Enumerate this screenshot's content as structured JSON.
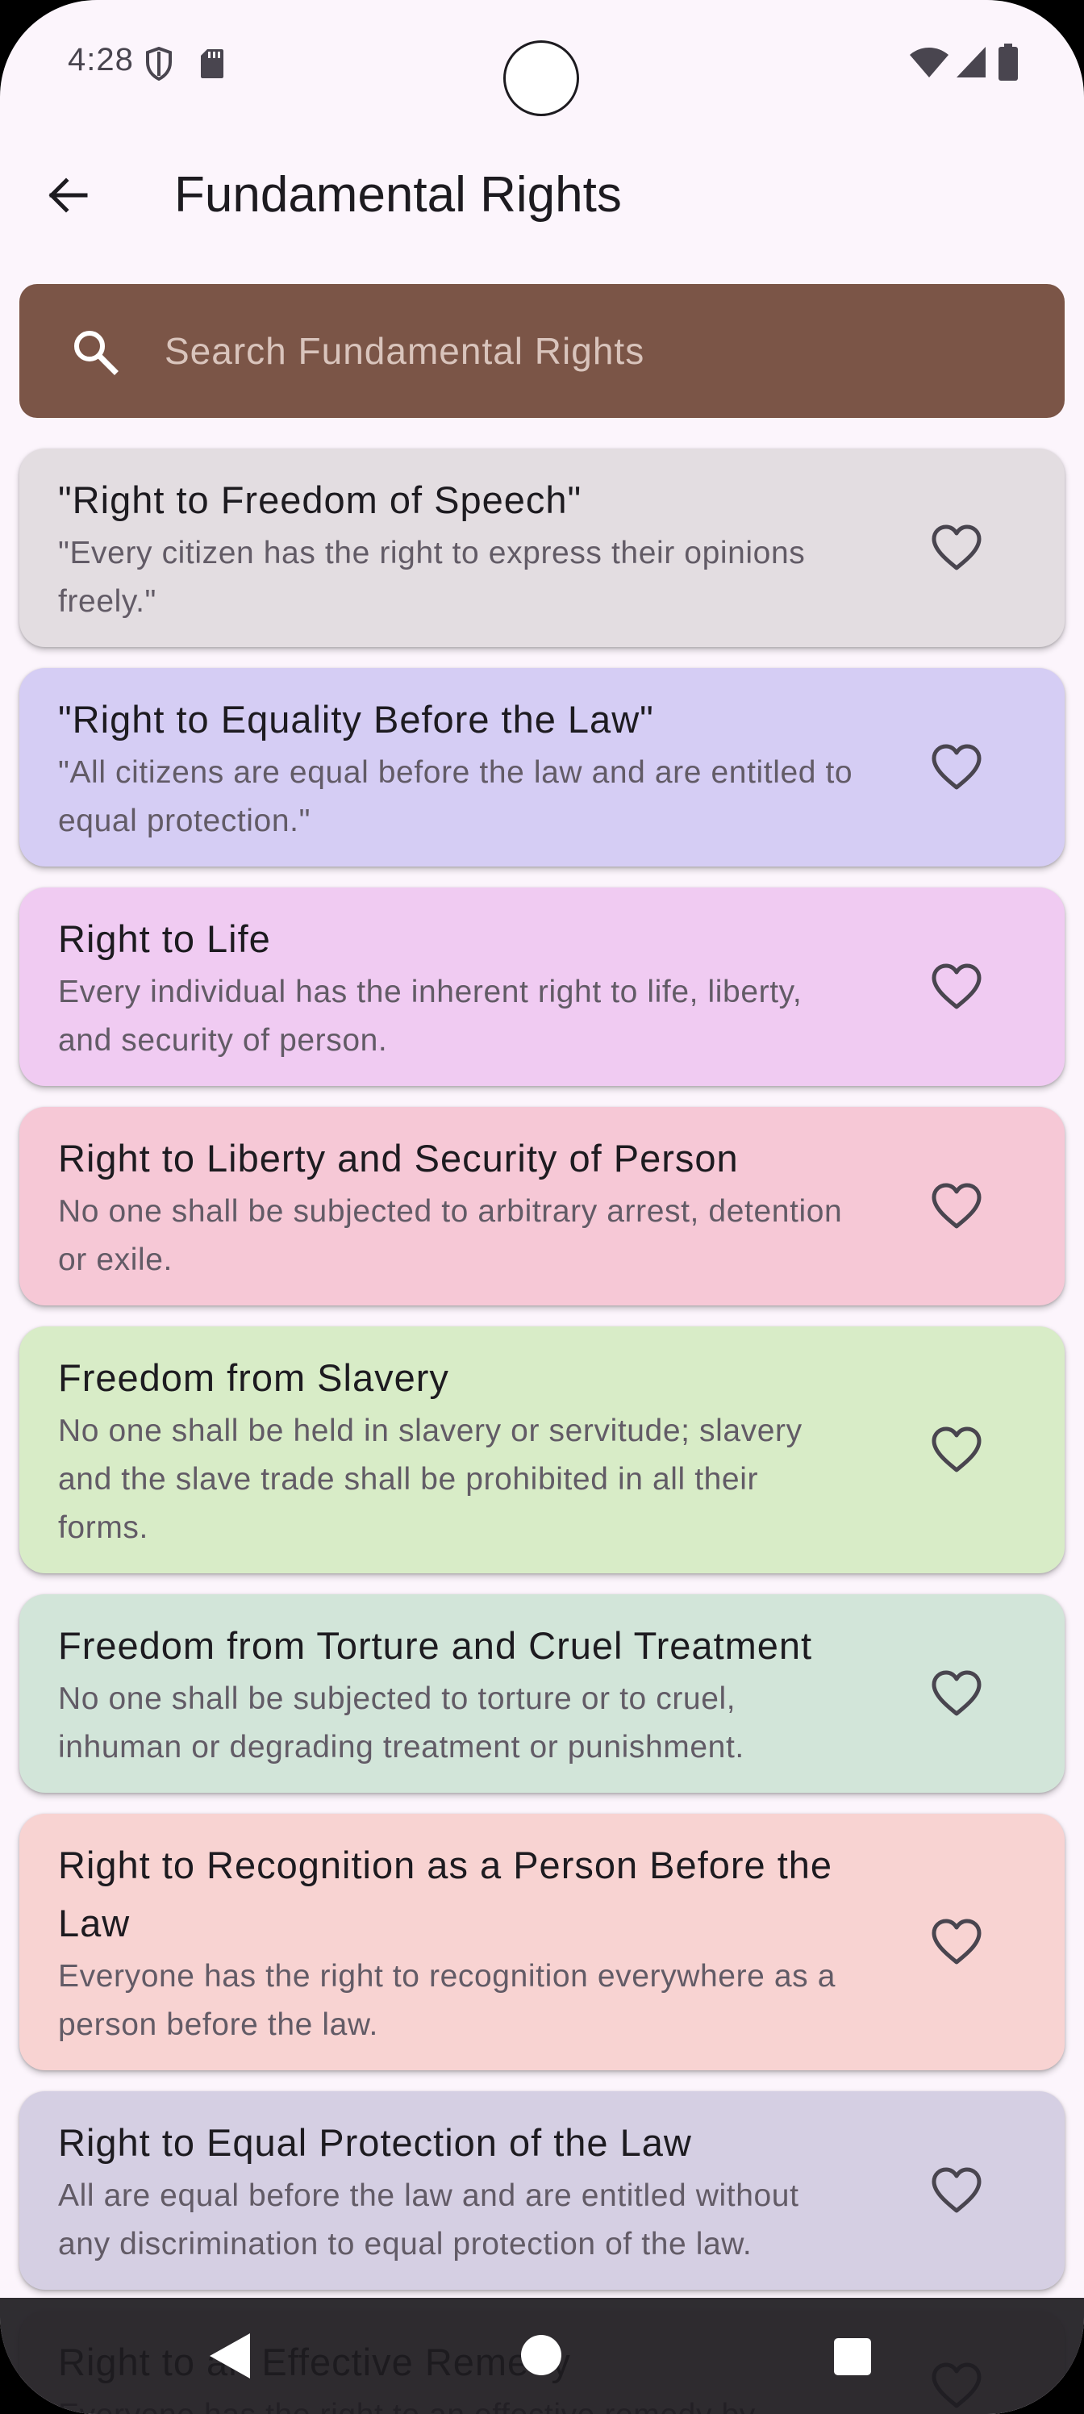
{
  "status_bar": {
    "time": "4:28"
  },
  "app_bar": {
    "title": "Fundamental Rights"
  },
  "search": {
    "placeholder": "Search Fundamental Rights",
    "value": ""
  },
  "colors": {
    "background": "#fcf5fc",
    "search_bg": "#7b5547",
    "title_text": "#1d1b20",
    "desc_text": "#625b66"
  },
  "rights": [
    {
      "title": "\"Right to Freedom of Speech\"",
      "description": "\"Every citizen has the right to express their opinions freely.\"",
      "color": "#e3dde1"
    },
    {
      "title": "\"Right to Equality Before the Law\"",
      "description": "\"All citizens are equal before the law and are entitled to equal protection.\"",
      "color": "#d5cdf4"
    },
    {
      "title": "Right to Life",
      "description": "Every individual has the inherent right to life, liberty, and security of person.",
      "color": "#f0cbf2"
    },
    {
      "title": "Right to Liberty and Security of Person",
      "description": "No one shall be subjected to arbitrary arrest, detention or exile.",
      "color": "#f6c8d6"
    },
    {
      "title": "Freedom from Slavery",
      "description": "No one shall be held in slavery or servitude; slavery and the slave trade shall be prohibited in all their forms.",
      "color": "#d8ecc7"
    },
    {
      "title": "Freedom from Torture and Cruel Treatment",
      "description": "No one shall be subjected to torture or to cruel, inhuman or degrading treatment or punishment.",
      "color": "#d2e5d9"
    },
    {
      "title": "Right to Recognition as a Person Before the Law",
      "description": "Everyone has the right to recognition everywhere as a person before the law.",
      "color": "#f8d3d2"
    },
    {
      "title": "Right to Equal Protection of the Law",
      "description": "All are equal before the law and are entitled without any discrimination to equal protection of the law.",
      "color": "#d5cfe3"
    },
    {
      "title": "Right to an Effective Remedy",
      "description": "Everyone has the right to an effective remedy by",
      "color": "#e8dfe6"
    }
  ]
}
